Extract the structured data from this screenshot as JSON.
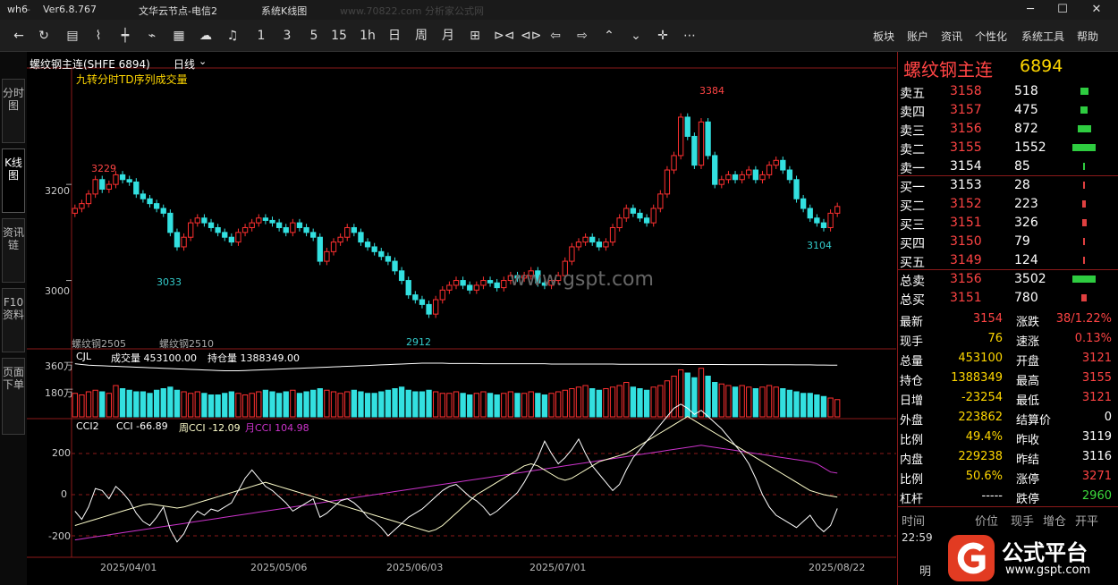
{
  "titlebar": {
    "app": "wh6",
    "version": "Ver6.8.767",
    "server": "文华云节点-电信2",
    "menu": "系统K线图",
    "watermark": "www.70822.com  分析家公式网"
  },
  "toolbar": {
    "icons": [
      "back-icon",
      "refresh-icon",
      "list-icon",
      "line-chart-icon",
      "kline-icon",
      "zigzag-icon",
      "grid-icon",
      "cloud-icon",
      "bell-icon"
    ],
    "periods": [
      "1",
      "3",
      "5",
      "15",
      "1h",
      "日",
      "周",
      "月"
    ],
    "nav_icons": [
      "self-icon",
      "zoom-in-icon",
      "zoom-out-icon",
      "left-arrow-icon",
      "right-arrow-icon",
      "up-arrow-icon",
      "down-arrow-icon",
      "crosshair-icon",
      "more-icon"
    ],
    "menu": [
      "板块",
      "账户",
      "资讯",
      "个性化",
      "系统工具",
      "帮助"
    ]
  },
  "sidetabs": [
    "分时图",
    "K线图",
    "资讯链",
    "F10资料",
    "页面下单"
  ],
  "chart": {
    "header": {
      "symbol": "螺纹钢主连(SHFE 6894)",
      "period": "日线",
      "indicator": "九转分时TD序列成交量"
    },
    "price_axis": [
      "3200",
      "3000"
    ],
    "price_labels": {
      "high_left": "3229",
      "low_left": "3033",
      "low_mid": "2912",
      "peak": "3384",
      "low_right": "3104"
    },
    "contract_labels": [
      "螺纹钢2505",
      "螺纹钢2510"
    ],
    "volume_header": {
      "name": "CJL",
      "vol": "成交量 453100.00",
      "oi": "持仓量 1388349.00"
    },
    "volume_axis": [
      "360万",
      "180万"
    ],
    "cci_header": {
      "name": "CCI2",
      "cci": "CCI -66.89",
      "week": "周CCI -12.09",
      "month": "月CCI 104.98"
    },
    "cci_axis": [
      "200",
      "0",
      "-200"
    ],
    "dates": [
      "2025/04/01",
      "2025/05/06",
      "2025/06/03",
      "2025/07/01",
      "2025/08/22"
    ],
    "logo_text": "www.gspt.com"
  },
  "chart_data": {
    "type": "candlestick",
    "title": "螺纹钢主连(SHFE 6894) 日线",
    "ylim": [
      2880,
      3420
    ],
    "closes": [
      3150,
      3160,
      3180,
      3210,
      3190,
      3200,
      3220,
      3210,
      3205,
      3180,
      3170,
      3160,
      3150,
      3140,
      3100,
      3070,
      3090,
      3120,
      3130,
      3120,
      3110,
      3100,
      3090,
      3080,
      3100,
      3110,
      3120,
      3130,
      3125,
      3120,
      3110,
      3100,
      3120,
      3110,
      3100,
      3090,
      3040,
      3060,
      3080,
      3090,
      3110,
      3100,
      3080,
      3070,
      3060,
      3050,
      3040,
      3020,
      3000,
      2970,
      2960,
      2950,
      2930,
      2960,
      2980,
      2990,
      3000,
      2990,
      2980,
      2990,
      3000,
      2995,
      2985,
      3000,
      3010,
      3005,
      3010,
      3020,
      2995,
      2990,
      3000,
      3010,
      3040,
      3070,
      3080,
      3090,
      3080,
      3070,
      3080,
      3110,
      3130,
      3150,
      3140,
      3130,
      3120,
      3150,
      3180,
      3230,
      3260,
      3340,
      3300,
      3240,
      3330,
      3260,
      3200,
      3210,
      3220,
      3210,
      3220,
      3230,
      3210,
      3220,
      3240,
      3250,
      3230,
      3210,
      3170,
      3150,
      3130,
      3120,
      3110,
      3140,
      3154
    ],
    "volume_wan": [
      150,
      140,
      160,
      170,
      160,
      150,
      200,
      180,
      170,
      160,
      160,
      150,
      170,
      180,
      190,
      170,
      160,
      150,
      160,
      150,
      140,
      140,
      150,
      160,
      150,
      140,
      150,
      160,
      170,
      160,
      150,
      160,
      170,
      150,
      160,
      170,
      180,
      170,
      160,
      150,
      160,
      170,
      160,
      150,
      150,
      160,
      170,
      180,
      190,
      170,
      160,
      160,
      170,
      160,
      150,
      150,
      160,
      150,
      140,
      150,
      160,
      150,
      140,
      150,
      160,
      150,
      150,
      160,
      150,
      140,
      150,
      160,
      170,
      180,
      190,
      200,
      180,
      170,
      180,
      190,
      200,
      220,
      190,
      180,
      170,
      190,
      200,
      230,
      260,
      300,
      280,
      250,
      310,
      260,
      220,
      210,
      200,
      190,
      200,
      190,
      180,
      190,
      200,
      190,
      180,
      170,
      160,
      150,
      150,
      140,
      130,
      120,
      110
    ],
    "open_interest_wan": [
      210,
      205,
      200,
      198,
      196,
      194,
      192,
      190,
      188,
      186,
      184,
      182,
      180,
      178,
      176,
      174,
      172,
      170,
      168,
      166,
      164,
      162,
      160,
      160,
      160,
      162,
      164,
      166,
      168,
      170,
      172,
      174,
      176,
      178,
      180,
      182,
      184,
      186,
      188,
      190,
      192,
      194,
      196,
      198,
      200,
      202,
      204,
      206,
      208,
      210,
      212,
      214,
      214,
      214,
      214,
      212,
      212,
      212,
      212,
      212,
      210,
      210,
      210,
      210,
      210,
      210,
      210,
      210,
      210,
      210,
      208,
      208,
      208,
      208,
      208,
      208,
      208,
      208,
      208,
      208,
      206,
      206,
      206,
      206,
      206,
      206,
      206,
      206,
      206,
      206,
      205,
      205,
      205,
      205,
      205,
      205,
      204,
      204,
      204,
      204,
      204,
      204,
      203,
      203,
      203,
      203,
      202,
      202,
      202,
      201,
      201,
      200,
      200
    ],
    "cci": [
      -80,
      -120,
      -60,
      30,
      20,
      -20,
      40,
      10,
      -30,
      -90,
      -130,
      -150,
      -110,
      -60,
      -170,
      -230,
      -190,
      -120,
      -80,
      -100,
      -70,
      -80,
      -60,
      -40,
      20,
      80,
      120,
      80,
      40,
      20,
      -10,
      -40,
      -80,
      -60,
      -40,
      -20,
      -110,
      -90,
      -60,
      -30,
      -20,
      -40,
      -70,
      -110,
      -130,
      -160,
      -200,
      -170,
      -140,
      -110,
      -90,
      -70,
      -40,
      -10,
      20,
      40,
      50,
      20,
      -10,
      -30,
      -60,
      -100,
      -80,
      -50,
      -20,
      10,
      60,
      120,
      180,
      260,
      200,
      150,
      180,
      220,
      270,
      200,
      140,
      100,
      60,
      20,
      50,
      120,
      180,
      220,
      260,
      300,
      340,
      380,
      420,
      440,
      420,
      390,
      410,
      380,
      350,
      320,
      280,
      240,
      200,
      150,
      80,
      0,
      -60,
      -100,
      -120,
      -140,
      -160,
      -130,
      -100,
      -150,
      -180,
      -150,
      -66.89
    ],
    "week_cci": [
      -150,
      -140,
      -130,
      -120,
      -110,
      -100,
      -90,
      -80,
      -70,
      -60,
      -50,
      -45,
      -50,
      -55,
      -60,
      -65,
      -60,
      -50,
      -40,
      -30,
      -20,
      -10,
      0,
      10,
      20,
      30,
      40,
      50,
      60,
      50,
      40,
      30,
      20,
      10,
      0,
      -10,
      -20,
      -30,
      -40,
      -50,
      -60,
      -70,
      -80,
      -90,
      -100,
      -110,
      -120,
      -130,
      -140,
      -150,
      -160,
      -170,
      -180,
      -170,
      -150,
      -120,
      -90,
      -60,
      -30,
      0,
      20,
      40,
      60,
      80,
      100,
      120,
      140,
      150,
      140,
      120,
      100,
      80,
      70,
      80,
      100,
      120,
      140,
      160,
      170,
      180,
      190,
      200,
      220,
      240,
      260,
      280,
      300,
      320,
      340,
      360,
      380,
      360,
      340,
      320,
      300,
      280,
      260,
      240,
      220,
      200,
      180,
      160,
      140,
      120,
      100,
      80,
      60,
      40,
      20,
      10,
      0,
      -6,
      -12.09
    ],
    "month_cci": [
      -220,
      -215,
      -210,
      -205,
      -200,
      -195,
      -190,
      -185,
      -180,
      -175,
      -170,
      -165,
      -160,
      -155,
      -150,
      -145,
      -140,
      -135,
      -130,
      -125,
      -120,
      -115,
      -110,
      -105,
      -100,
      -95,
      -90,
      -85,
      -80,
      -75,
      -70,
      -65,
      -60,
      -55,
      -50,
      -45,
      -40,
      -35,
      -30,
      -25,
      -20,
      -15,
      -10,
      -5,
      0,
      5,
      10,
      15,
      20,
      25,
      30,
      35,
      40,
      45,
      50,
      55,
      60,
      65,
      70,
      75,
      80,
      85,
      90,
      95,
      100,
      105,
      110,
      115,
      120,
      125,
      130,
      135,
      140,
      145,
      150,
      155,
      160,
      165,
      170,
      175,
      180,
      185,
      190,
      195,
      200,
      205,
      210,
      215,
      220,
      225,
      230,
      235,
      240,
      235,
      230,
      225,
      220,
      215,
      210,
      205,
      200,
      195,
      190,
      185,
      180,
      175,
      170,
      165,
      160,
      150,
      130,
      110,
      104.98
    ]
  },
  "panel": {
    "title": "螺纹钢主连",
    "code": "6894",
    "asks": [
      {
        "label": "卖五",
        "price": "3158",
        "vol": "518",
        "bar": 0.33
      },
      {
        "label": "卖四",
        "price": "3157",
        "vol": "475",
        "bar": 0.31
      },
      {
        "label": "卖三",
        "price": "3156",
        "vol": "872",
        "bar": 0.56
      },
      {
        "label": "卖二",
        "price": "3155",
        "vol": "1552",
        "bar": 1.0
      },
      {
        "label": "卖一",
        "price": "3154",
        "vol": "85",
        "bar": 0.05
      }
    ],
    "bids": [
      {
        "label": "买一",
        "price": "3153",
        "vol": "28",
        "bar": 0.02
      },
      {
        "label": "买二",
        "price": "3152",
        "vol": "223",
        "bar": 0.14
      },
      {
        "label": "买三",
        "price": "3151",
        "vol": "326",
        "bar": 0.21
      },
      {
        "label": "买四",
        "price": "3150",
        "vol": "79",
        "bar": 0.05
      },
      {
        "label": "买五",
        "price": "3149",
        "vol": "124",
        "bar": 0.08
      }
    ],
    "totals": [
      {
        "label": "总卖",
        "price": "3156",
        "vol": "3502",
        "bar": 1.0
      },
      {
        "label": "总买",
        "price": "3151",
        "vol": "780",
        "bar": 0.22
      }
    ],
    "stats": [
      {
        "l1": "最新",
        "v1": "3154",
        "l2": "涨跌",
        "v2": "38/1.22%",
        "c1": "red",
        "c2": "red"
      },
      {
        "l1": "现手",
        "v1": "76",
        "l2": "速涨",
        "v2": "0.13%",
        "c1": "yel",
        "c2": "red"
      },
      {
        "l1": "总量",
        "v1": "453100",
        "l2": "开盘",
        "v2": "3121",
        "c1": "yel",
        "c2": "red"
      },
      {
        "l1": "持仓",
        "v1": "1388349",
        "l2": "最高",
        "v2": "3155",
        "c1": "yel",
        "c2": "red"
      },
      {
        "l1": "日增",
        "v1": "-23254",
        "l2": "最低",
        "v2": "3121",
        "c1": "yel",
        "c2": "red"
      },
      {
        "l1": "外盘",
        "v1": "223862",
        "l2": "结算价",
        "v2": "0",
        "c1": "yel",
        "c2": "wht"
      },
      {
        "l1": "比例",
        "v1": "49.4%",
        "l2": "昨收",
        "v2": "3119",
        "c1": "yel",
        "c2": "wht"
      },
      {
        "l1": "内盘",
        "v1": "229238",
        "l2": "昨结",
        "v2": "3116",
        "c1": "yel",
        "c2": "wht"
      },
      {
        "l1": "比例",
        "v1": "50.6%",
        "l2": "涨停",
        "v2": "3271",
        "c1": "yel",
        "c2": "red"
      },
      {
        "l1": "杠杆",
        "v1": "-----",
        "l2": "跌停",
        "v2": "2960",
        "c1": "wht",
        "c2": "grn"
      }
    ],
    "tick_header": [
      "时间",
      "价位",
      "现手",
      "增仓",
      "开平"
    ],
    "tick_time": "22:59",
    "logo": {
      "name": "公式平台",
      "url": "www.gspt.com"
    },
    "side_label": "明"
  },
  "colors": {
    "up": "#ff3030",
    "down": "#33e0e0",
    "grid": "#8b1a1a",
    "cci": "#ffffff",
    "week_cci": "#ffffcc",
    "month_cci": "#cc33cc"
  }
}
